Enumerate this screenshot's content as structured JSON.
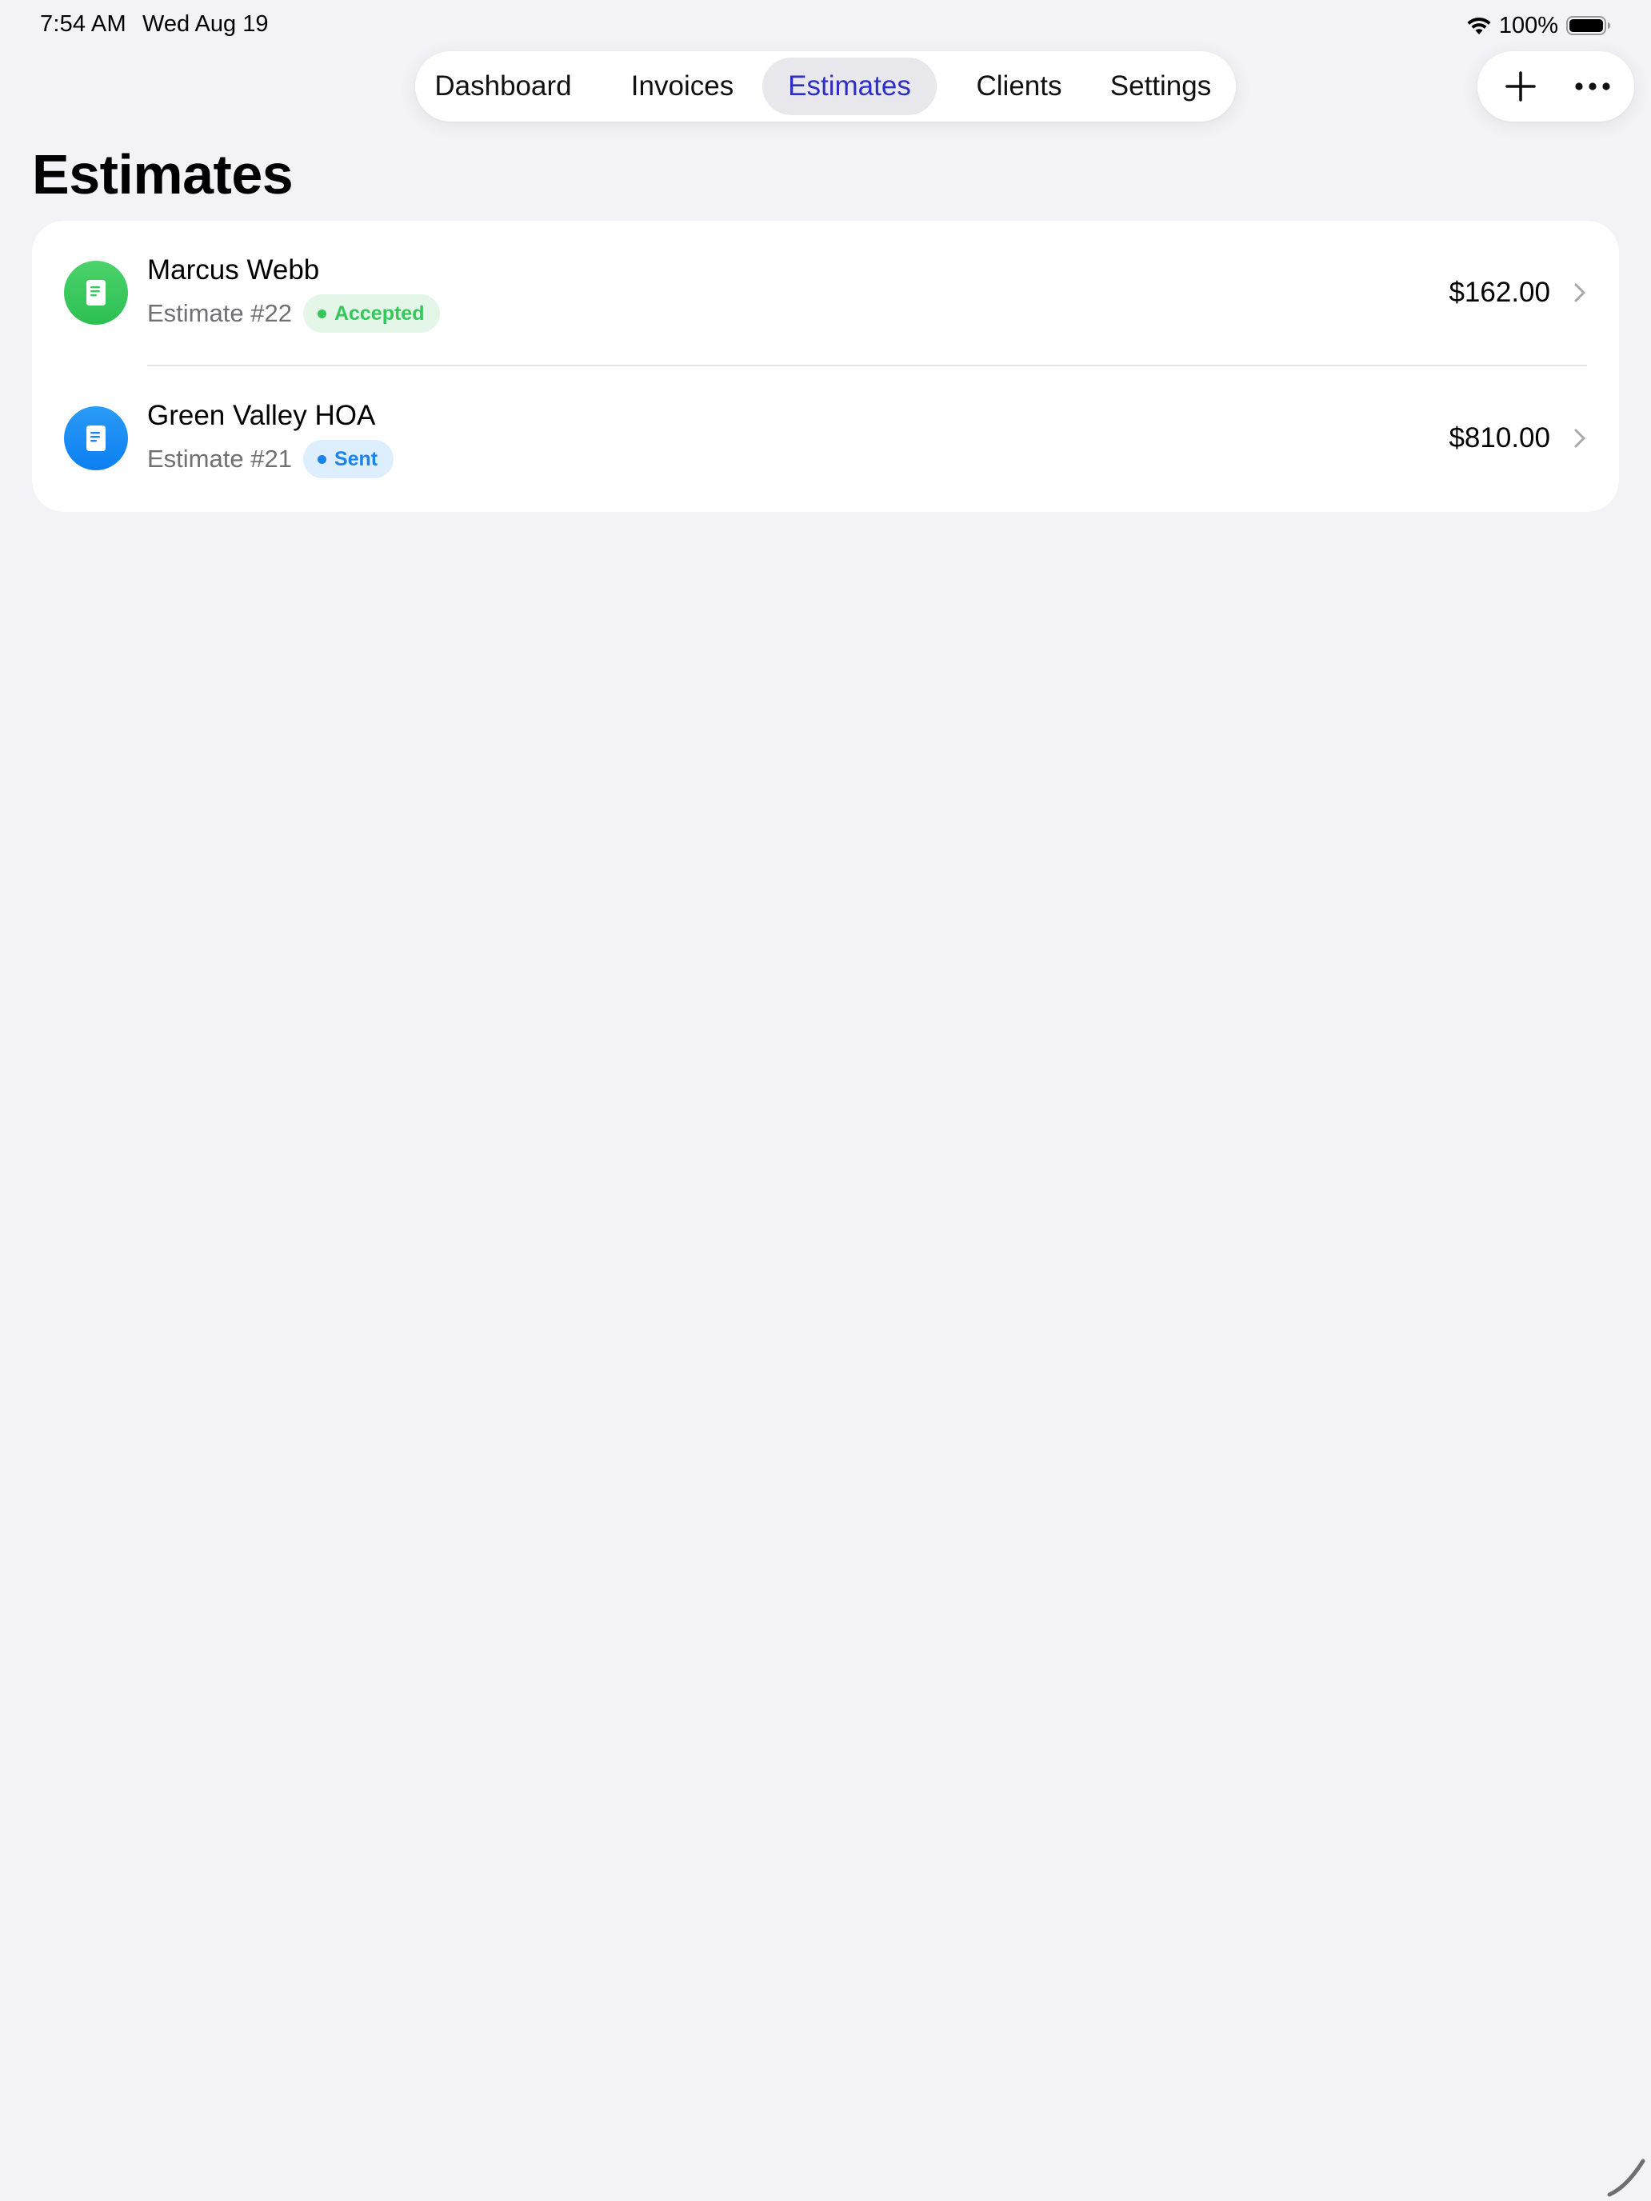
{
  "status_bar": {
    "time": "7:54 AM",
    "date": "Wed Aug 19",
    "battery": "100%",
    "icons": [
      "wifi-icon",
      "battery-icon"
    ]
  },
  "nav": {
    "tabs": [
      {
        "label": "Dashboard"
      },
      {
        "label": "Invoices"
      },
      {
        "label": "Estimates",
        "active": true
      },
      {
        "label": "Clients"
      },
      {
        "label": "Settings"
      }
    ],
    "accent_color": "#2d2ec6"
  },
  "actions": {
    "icons": [
      "plus-icon",
      "more-icon"
    ]
  },
  "page": {
    "title": "Estimates"
  },
  "estimates": [
    {
      "client": "Marcus Webb",
      "number": "Estimate #22",
      "status": "Accepted",
      "amount": "$162.00",
      "icon": "document-icon",
      "color": "#34c759"
    },
    {
      "client": "Green Valley HOA",
      "number": "Estimate #21",
      "status": "Sent",
      "amount": "$810.00",
      "icon": "document-icon",
      "color": "#1a84ee"
    }
  ]
}
